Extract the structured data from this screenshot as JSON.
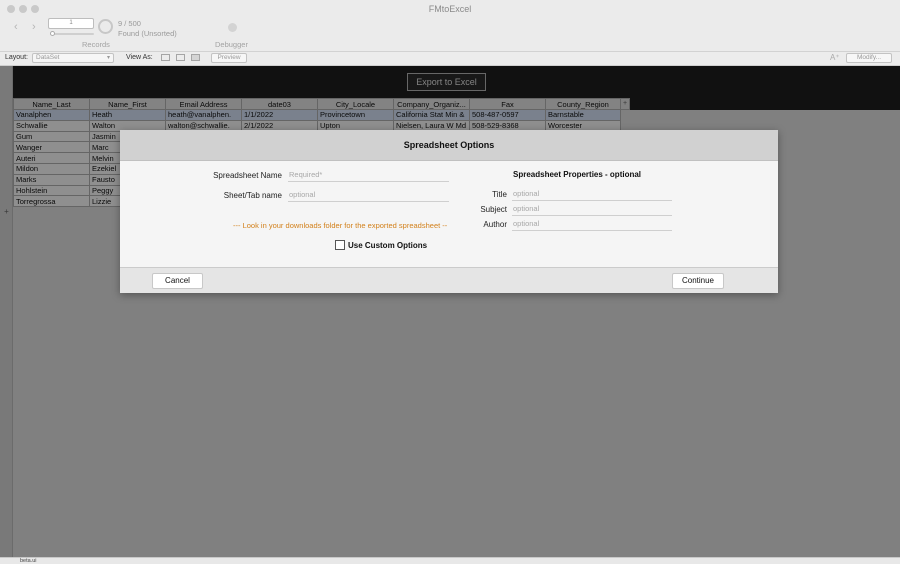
{
  "window": {
    "title": "FMtoExcel"
  },
  "toolbar": {
    "record_field": "1",
    "record_count": "9 / 500",
    "record_state": "Found (Unsorted)",
    "records_label": "Records",
    "debugger_label": "Debugger"
  },
  "layoutbar": {
    "layout_label": "Layout:",
    "layout_value": "DataSet",
    "view_as_label": "View As:",
    "preview_label": "Preview",
    "modify_label": "Modify..."
  },
  "header": {
    "export_button": "Export to Excel"
  },
  "table": {
    "columns": [
      "Name_Last",
      "Name_First",
      "Email Address",
      "date03",
      "City_Locale",
      "Company_Organiz...",
      "Fax",
      "County_Region"
    ],
    "rows": [
      [
        "Vanalphen",
        "Heath",
        "heath@vanalphen.",
        "1/1/2022",
        "Provincetown",
        "California Stat Min &",
        "508-487-0597",
        "Barnstable"
      ],
      [
        "Schwallie",
        "Walton",
        "walton@schwallie.",
        "2/1/2022",
        "Upton",
        "Nielsen, Laura W Md",
        "508-529-8368",
        "Worcester"
      ],
      [
        "Gum",
        "Jasmin",
        "",
        "",
        "",
        "",
        "",
        ""
      ],
      [
        "Wanger",
        "Marc",
        "",
        "",
        "",
        "",
        "",
        ""
      ],
      [
        "Auteri",
        "Melvin",
        "",
        "",
        "",
        "",
        "",
        ""
      ],
      [
        "Mildon",
        "Ezekiel",
        "",
        "",
        "",
        "",
        "",
        ""
      ],
      [
        "Marks",
        "Fausto",
        "",
        "",
        "",
        "",
        "",
        ""
      ],
      [
        "Hohlstein",
        "Peggy",
        "",
        "",
        "",
        "",
        "",
        ""
      ],
      [
        "Torregrossa",
        "Lizzie",
        "",
        "",
        "",
        "",
        "",
        ""
      ]
    ]
  },
  "statusbar": {
    "text": "beta.ui"
  },
  "dialog": {
    "title": "Spreadsheet Options",
    "spreadsheet_name_label": "Spreadsheet Name",
    "spreadsheet_name_placeholder": "Required*",
    "sheet_tab_label": "Sheet/Tab name",
    "sheet_tab_placeholder": "optional",
    "hint": "--- Look in your downloads folder for the exported spreadsheet --",
    "custom_options_label": "Use Custom Options",
    "properties_title": "Spreadsheet  Properties - optional",
    "title_label": "Title",
    "title_placeholder": "optional",
    "subject_label": "Subject",
    "subject_placeholder": "optional",
    "author_label": "Author",
    "author_placeholder": "optional",
    "cancel_label": "Cancel",
    "continue_label": "Continue"
  },
  "colors": {
    "header_band": "#1f1f1f",
    "hint_text": "#d2801b",
    "dialog_header": "#d1d1d1"
  }
}
